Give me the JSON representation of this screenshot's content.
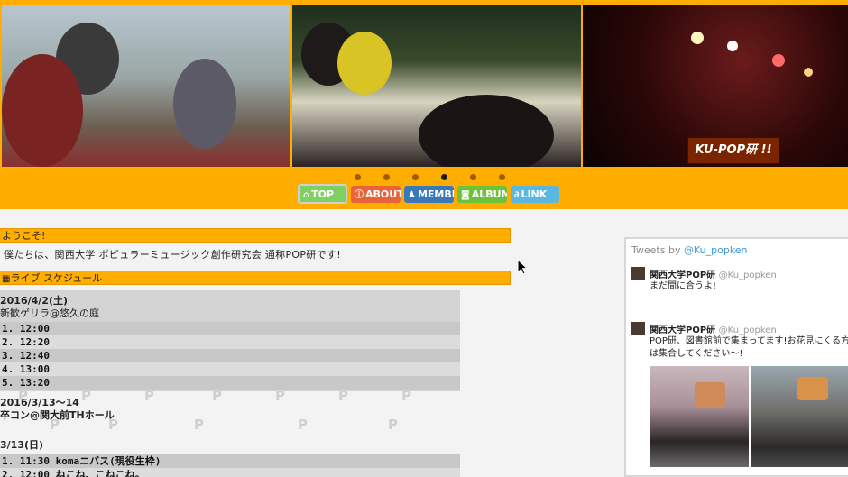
{
  "slider": {
    "caption": "KU-POP研 !!",
    "dots_count": 6,
    "active_dot": 3
  },
  "nav": {
    "items": [
      {
        "label": "TOP",
        "icon": "home-icon",
        "glyph": "⌂",
        "color": "#7fcf62",
        "id": "top"
      },
      {
        "label": "ABOUT",
        "icon": "info-icon",
        "glyph": "ⓘ",
        "color": "#e8623a",
        "id": "about"
      },
      {
        "label": "MEMBER",
        "icon": "person-icon",
        "glyph": "♟",
        "color": "#3c78b8",
        "id": "member"
      },
      {
        "label": "ALBUM",
        "icon": "camera-icon",
        "glyph": "◙",
        "color": "#6cc23a",
        "id": "album"
      },
      {
        "label": "LINK",
        "icon": "link-icon",
        "glyph": "∂",
        "color": "#5ab8e0",
        "id": "link"
      }
    ]
  },
  "welcome": {
    "heading": "ようこそ!",
    "text": "僕たちは、関西大学 ポピュラーミュージック創作研究会 通称POP研です!"
  },
  "schedule": {
    "heading": "ライブ スケジュール",
    "events": [
      {
        "date": "2016/4/2(土)",
        "place": "新歓ゲリラ@悠久の庭",
        "rows": [
          "1. 12:00",
          "2. 12:20",
          "3. 12:40",
          "4. 13:00",
          "5. 13:20"
        ]
      },
      {
        "date": "2016/3/13〜14",
        "place": "卒コン@関大前THホール",
        "rows": []
      },
      {
        "date": "3/13(日)",
        "place": "",
        "rows": [
          "1. 11:30  komaニバス(現役生枠)",
          "2. 12:00  ねこね、こねこね。"
        ]
      }
    ]
  },
  "twitter": {
    "header_prefix": "Tweets",
    "header_by": "by",
    "header_handle": "@Ku_popken",
    "tweets": [
      {
        "name": "関西大学POP研",
        "handle": "@Ku_popken",
        "text": "まだ間に合うよ!"
      },
      {
        "name": "関西大学POP研",
        "handle": "@Ku_popken",
        "text": "POP研、図書館前で集まってます!お花見にくる方は集合してください〜!"
      }
    ]
  }
}
